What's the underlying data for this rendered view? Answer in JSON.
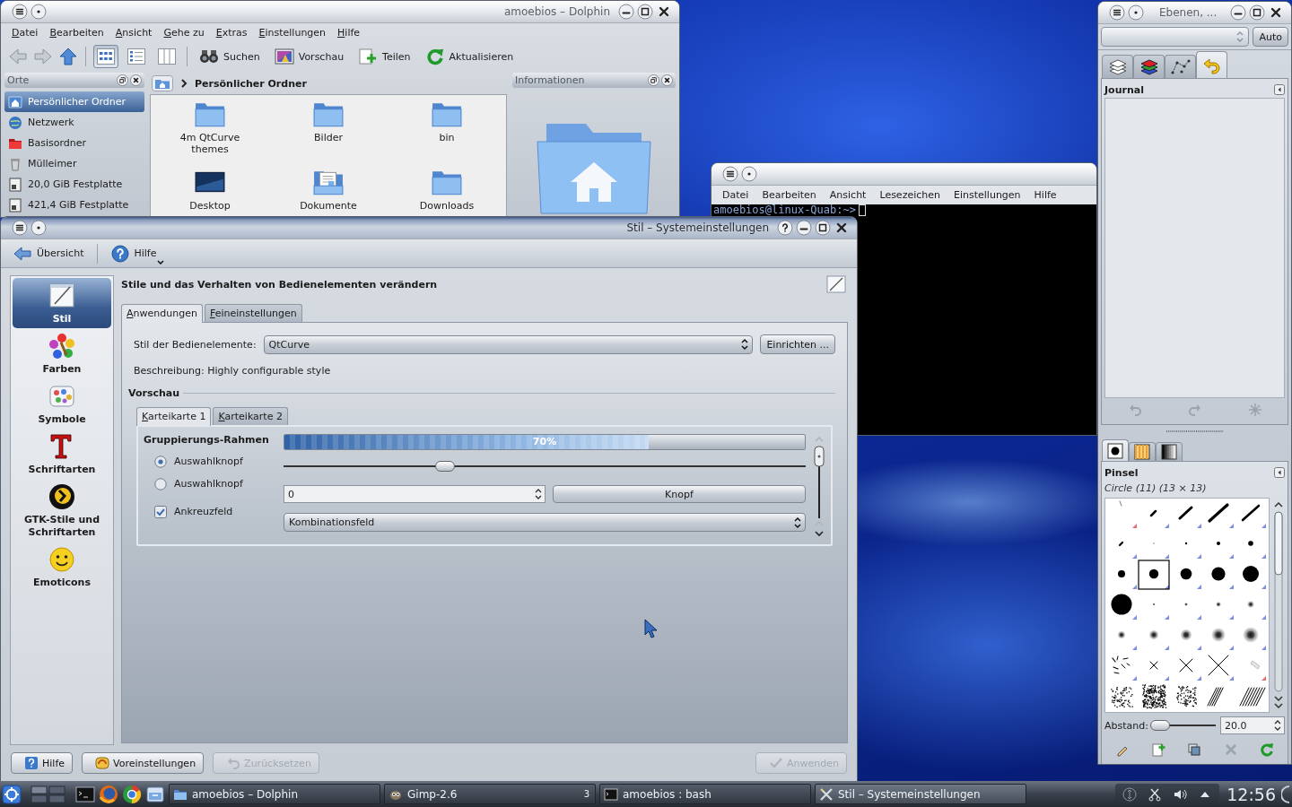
{
  "dolphin": {
    "title": "amoebios – Dolphin",
    "menu": [
      "Datei",
      "Bearbeiten",
      "Ansicht",
      "Gehe zu",
      "Extras",
      "Einstellungen",
      "Hilfe"
    ],
    "view_modes": [
      {
        "selected": true
      },
      {
        "selected": false
      },
      {
        "selected": false
      }
    ],
    "actions": [
      "Suchen",
      "Vorschau",
      "Teilen",
      "Aktualisieren"
    ],
    "places": {
      "title": "Orte",
      "items": [
        {
          "label": "Persönlicher Ordner",
          "kind": "home",
          "selected": true
        },
        {
          "label": "Netzwerk",
          "kind": "network",
          "selected": false
        },
        {
          "label": "Basisordner",
          "kind": "root",
          "selected": false
        },
        {
          "label": "Mülleimer",
          "kind": "trash",
          "selected": false
        },
        {
          "label": "20,0 GiB Festplatte",
          "kind": "disk",
          "selected": false
        },
        {
          "label": "421,4 GiB Festplatte",
          "kind": "disk",
          "selected": false
        }
      ]
    },
    "breadcrumb": "Persönlicher Ordner",
    "files": [
      {
        "name": "4m QtCurve themes",
        "kind": "folder"
      },
      {
        "name": "Bilder",
        "kind": "folder"
      },
      {
        "name": "bin",
        "kind": "folder"
      },
      {
        "name": "Desktop",
        "kind": "desktop"
      },
      {
        "name": "Dokumente",
        "kind": "documents"
      },
      {
        "name": "Downloads",
        "kind": "folder"
      }
    ],
    "info_panel": {
      "title": "Informationen"
    }
  },
  "terminal": {
    "menu": [
      "Datei",
      "Bearbeiten",
      "Ansicht",
      "Lesezeichen",
      "Einstellungen",
      "Hilfe"
    ],
    "prompt": "amoebios@linux-Quab:~>"
  },
  "settings": {
    "title": "Stil – Systemeinstellungen",
    "back": "Übersicht",
    "help": "Hilfe",
    "categories": [
      {
        "label": "Stil",
        "selected": true
      },
      {
        "label": "Farben",
        "selected": false
      },
      {
        "label": "Symbole",
        "selected": false
      },
      {
        "label": "Schriftarten",
        "selected": false
      },
      {
        "label": "GTK-Stile und Schriftarten",
        "selected": false
      },
      {
        "label": "Emoticons",
        "selected": false
      }
    ],
    "heading": "Stile und das Verhalten von Bedienelementen verändern",
    "tabs": [
      {
        "label": "Anwendungen",
        "selected": true
      },
      {
        "label": "Feineinstellungen",
        "selected": false
      }
    ],
    "style_field": {
      "label": "Stil der Bedienelemente:",
      "value": "QtCurve"
    },
    "configure_button": "Einrichten ...",
    "description": "Beschreibung: Highly configurable style",
    "preview": {
      "title": "Vorschau",
      "tabs": [
        {
          "label": "Karteikarte 1",
          "selected": true
        },
        {
          "label": "Karteikarte 2",
          "selected": false
        }
      ],
      "group_title": "Gruppierungs-Rahmen",
      "radios": [
        {
          "label": "Auswahlknopf",
          "selected": true
        },
        {
          "label": "Auswahlknopf",
          "selected": false
        }
      ],
      "checkbox": {
        "label": "Ankreuzfeld",
        "checked": true
      },
      "progress": {
        "level": 0.7,
        "reading": "70%"
      },
      "slider": {
        "level": 0.31
      },
      "spinbox": {
        "value": "0"
      },
      "button": "Knopf",
      "combobox": {
        "value": "Kombinationsfeld"
      }
    },
    "buttons": [
      {
        "label": "Hilfe",
        "disabled": false
      },
      {
        "label": "Voreinstellungen",
        "disabled": false
      },
      {
        "label": "Zurücksetzen",
        "disabled": true
      },
      {
        "label": "Anwenden",
        "disabled": true
      }
    ]
  },
  "gimp": {
    "title": "Ebenen, ...",
    "auto_button": "Auto",
    "tabs": [
      {
        "selected": false
      },
      {
        "selected": false
      },
      {
        "selected": false
      },
      {
        "selected": true
      }
    ],
    "journal": {
      "title": "Journal",
      "buttons": [
        {
          "disabled": true
        },
        {
          "disabled": true
        },
        {
          "disabled": true
        }
      ]
    },
    "brush_tabs": [
      {
        "selected": true
      },
      {
        "selected": false
      },
      {
        "selected": false
      }
    ],
    "brushes": {
      "title": "Pinsel",
      "current": "Circle (11) (13 × 13)",
      "items": [
        {
          "selected": false
        },
        {
          "selected": false
        },
        {
          "selected": false
        },
        {
          "selected": false
        },
        {
          "selected": false
        },
        {
          "selected": false
        },
        {
          "selected": false
        },
        {
          "selected": false
        },
        {
          "selected": false
        },
        {
          "selected": false
        },
        {
          "selected": false
        },
        {
          "selected": true
        },
        {
          "selected": false
        },
        {
          "selected": false
        },
        {
          "selected": false
        },
        {
          "selected": false
        },
        {
          "selected": false
        },
        {
          "selected": false
        },
        {
          "selected": false
        },
        {
          "selected": false
        },
        {
          "selected": false
        },
        {
          "selected": false
        },
        {
          "selected": false
        },
        {
          "selected": false
        },
        {
          "selected": false
        },
        {
          "selected": false
        },
        {
          "selected": false
        },
        {
          "selected": false
        },
        {
          "selected": false
        },
        {
          "selected": false
        },
        {
          "selected": false
        },
        {
          "selected": false
        },
        {
          "selected": false
        },
        {
          "selected": false
        },
        {
          "selected": false
        }
      ]
    },
    "spacing": {
      "label": "Abstand:",
      "level": 0.12,
      "value": "20.0"
    },
    "buttons": [
      {
        "disabled": false
      },
      {
        "disabled": false
      },
      {
        "disabled": false
      },
      {
        "disabled": true
      },
      {
        "disabled": false
      }
    ]
  },
  "taskbar": {
    "tasks": [
      {
        "label": "amoebios – Dolphin",
        "selected": false
      },
      {
        "label": "Gimp-2.6",
        "count": "3",
        "selected": false
      },
      {
        "label": "amoebios : bash",
        "selected": false
      },
      {
        "label": "Stil – Systemeinstellungen",
        "selected": true
      }
    ],
    "clock": "12:56"
  }
}
